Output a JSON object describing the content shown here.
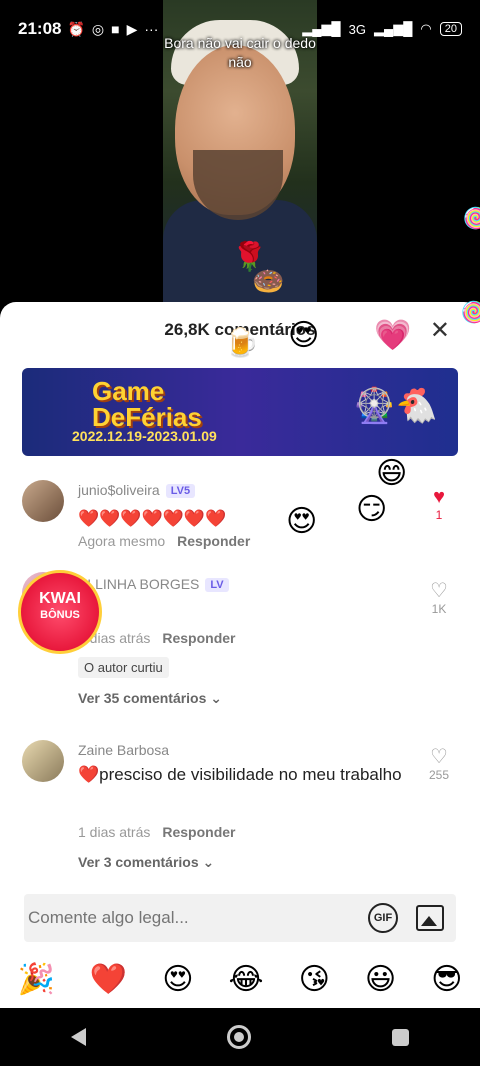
{
  "status_bar": {
    "time": "21:08",
    "battery": "20",
    "network": "3G"
  },
  "video": {
    "caption": "Bora não vai cair o dedo não"
  },
  "sheet": {
    "title": "26,8K comentários"
  },
  "banner": {
    "title_line1": "Game",
    "title_line2": "DeFérias",
    "date": "2022.12.19-2023.01.09"
  },
  "comments": [
    {
      "username": "junio$oliveira",
      "level": "LV5",
      "text": "❤️❤️❤️❤️❤️❤️❤️",
      "time": "Agora mesmo",
      "reply": "Responder",
      "likes": "1"
    },
    {
      "username": "ELLINHA BORGES",
      "level": "LV",
      "text": "❤️",
      "time": "1 dias atrás",
      "reply": "Responder",
      "likes": "1K",
      "author_liked": "O autor curtiu",
      "view_more": "Ver 35 comentários"
    },
    {
      "username": "Zaine Barbosa",
      "text": "❤️presciso de visibilidade no meu trabalho",
      "time": "1 dias atrás",
      "reply": "Responder",
      "likes": "255",
      "view_more": "Ver 3 comentários"
    }
  ],
  "input": {
    "placeholder": "Comente algo legal...",
    "gif_label": "GIF"
  },
  "emojis": [
    "🎉",
    "❤️",
    "😍",
    "😂",
    "😘",
    "😃",
    "😎"
  ],
  "kwai_bonus": {
    "line1": "KWAI",
    "line2": "BÔNUS"
  },
  "floating_emojis": [
    "😍",
    "🍺",
    "🌹",
    "🍩",
    "🍭",
    "💗",
    "😄",
    "😏",
    "😍",
    "🍭"
  ]
}
